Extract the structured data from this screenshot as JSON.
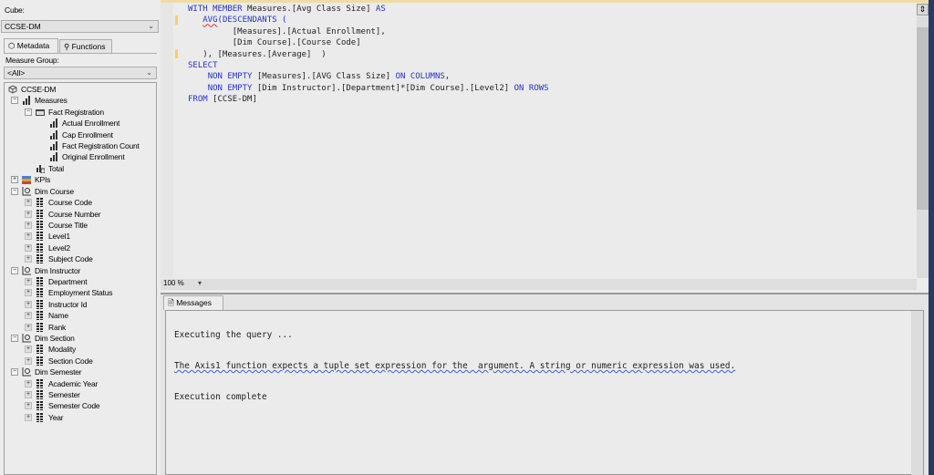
{
  "left_panel": {
    "cube_label": "Cube:",
    "cube_value": "CCSE-DM",
    "tabs": [
      {
        "label": "Metadata",
        "icon": "cube-icon"
      },
      {
        "label": "Functions",
        "icon": "function-icon"
      }
    ],
    "measure_group_label": "Measure Group:",
    "measure_group_value": "<All>",
    "tree": [
      {
        "label": "CCSE-DM",
        "level": 0,
        "icon": "cube",
        "exp": ""
      },
      {
        "label": "Measures",
        "level": 1,
        "icon": "measure",
        "exp": "-"
      },
      {
        "label": "Fact Registration",
        "level": 2,
        "icon": "folder",
        "exp": "-"
      },
      {
        "label": "Actual Enrollment",
        "level": 3,
        "icon": "measure",
        "exp": ""
      },
      {
        "label": "Cap Enrollment",
        "level": 3,
        "icon": "measure",
        "exp": ""
      },
      {
        "label": "Fact Registration Count",
        "level": 3,
        "icon": "measure",
        "exp": ""
      },
      {
        "label": "Original Enrollment",
        "level": 3,
        "icon": "measure",
        "exp": ""
      },
      {
        "label": "Total",
        "level": 2,
        "icon": "calc",
        "exp": ""
      },
      {
        "label": "KPIs",
        "level": 1,
        "icon": "kpi",
        "exp": "+"
      },
      {
        "label": "Dim Course",
        "level": 1,
        "icon": "dimension",
        "exp": "-"
      },
      {
        "label": "Course Code",
        "level": 2,
        "icon": "attribute",
        "exp": "+"
      },
      {
        "label": "Course Number",
        "level": 2,
        "icon": "attribute",
        "exp": "+"
      },
      {
        "label": "Course Title",
        "level": 2,
        "icon": "attribute",
        "exp": "+"
      },
      {
        "label": "Level1",
        "level": 2,
        "icon": "attribute",
        "exp": "+"
      },
      {
        "label": "Level2",
        "level": 2,
        "icon": "attribute",
        "exp": "+"
      },
      {
        "label": "Subject Code",
        "level": 2,
        "icon": "attribute",
        "exp": "+"
      },
      {
        "label": "Dim Instructor",
        "level": 1,
        "icon": "dimension",
        "exp": "-"
      },
      {
        "label": "Department",
        "level": 2,
        "icon": "attribute",
        "exp": "+"
      },
      {
        "label": "Employment Status",
        "level": 2,
        "icon": "attribute",
        "exp": "+"
      },
      {
        "label": "Instructor Id",
        "level": 2,
        "icon": "attribute",
        "exp": "+"
      },
      {
        "label": "Name",
        "level": 2,
        "icon": "attribute",
        "exp": "+"
      },
      {
        "label": "Rank",
        "level": 2,
        "icon": "attribute",
        "exp": "+"
      },
      {
        "label": "Dim Section",
        "level": 1,
        "icon": "dimension",
        "exp": "-"
      },
      {
        "label": "Modality",
        "level": 2,
        "icon": "attribute",
        "exp": "+"
      },
      {
        "label": "Section Code",
        "level": 2,
        "icon": "attribute",
        "exp": "+"
      },
      {
        "label": "Dim Semester",
        "level": 1,
        "icon": "dimension",
        "exp": "-"
      },
      {
        "label": "Academic Year",
        "level": 2,
        "icon": "attribute",
        "exp": "+"
      },
      {
        "label": "Semester",
        "level": 2,
        "icon": "attribute",
        "exp": "+"
      },
      {
        "label": "Semester Code",
        "level": 2,
        "icon": "attribute",
        "exp": "+"
      },
      {
        "label": "Year",
        "level": 2,
        "icon": "attribute",
        "exp": "+"
      }
    ]
  },
  "editor": {
    "lines": [
      [
        [
          "kw",
          "WITH MEMBER "
        ],
        [
          "",
          "Measures.[Avg Class Size] "
        ],
        [
          "kw",
          "AS"
        ]
      ],
      [
        [
          "",
          "   "
        ],
        [
          "kw sq",
          "AVG"
        ],
        [
          "kw",
          "(DESCENDANTS ("
        ]
      ],
      [
        [
          "",
          "         [Measures].[Actual Enrollment],"
        ]
      ],
      [
        [
          "",
          "         [Dim Course].[Course Code]"
        ]
      ],
      [
        [
          "",
          "   ), [Measures.[Average]  )"
        ]
      ],
      [
        [
          "kw",
          "SELECT"
        ]
      ],
      [
        [
          "",
          "    "
        ],
        [
          "kw",
          "NON EMPTY "
        ],
        [
          "",
          "[Measures].[AVG Class Size] "
        ],
        [
          "kw",
          "ON COLUMNS"
        ],
        [
          "",
          ","
        ]
      ],
      [
        [
          "",
          "    "
        ],
        [
          "kw",
          "NON EMPTY "
        ],
        [
          "",
          "[Dim Instructor].[Department]*[Dim Course].[Level2] "
        ],
        [
          "kw",
          "ON ROWS"
        ]
      ],
      [
        [
          "kw",
          "FROM "
        ],
        [
          "",
          "[CCSE-DM]"
        ]
      ]
    ],
    "zoom_value": "100 %"
  },
  "results": {
    "tab_label": "Messages",
    "messages": [
      "Executing the query ...",
      "The Axis1 function expects a tuple set expression for the  argument. A string or numeric expression was used.",
      "Execution complete"
    ]
  }
}
